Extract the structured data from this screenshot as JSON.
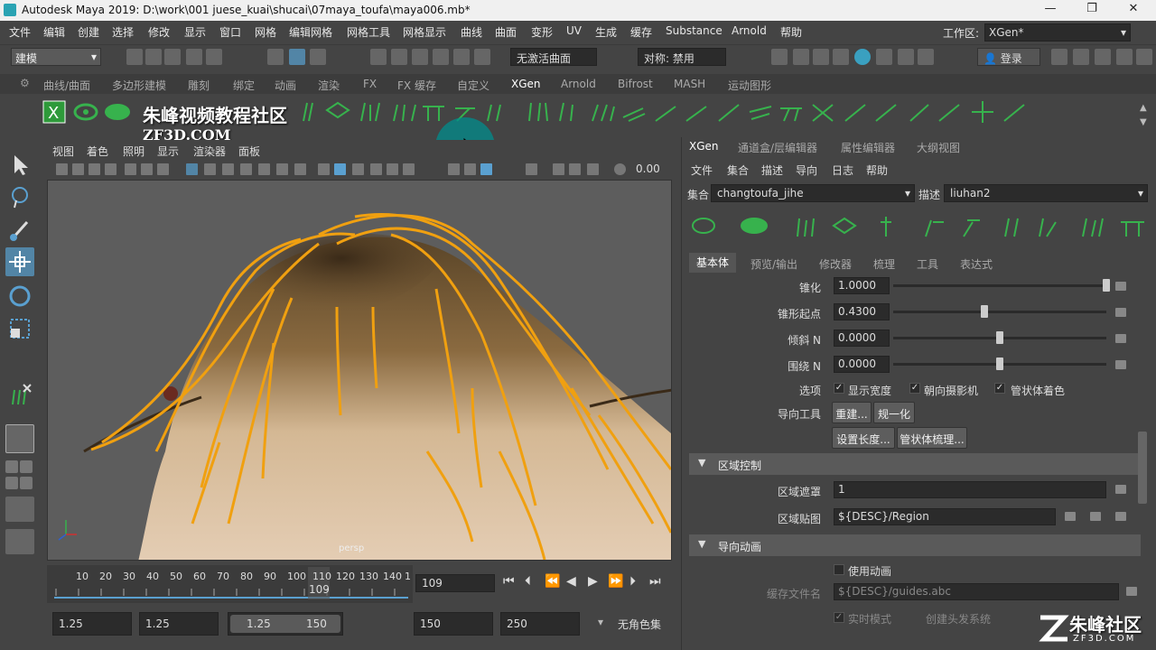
{
  "window": {
    "title": "Autodesk Maya 2019: D:\\work\\001 juese_kuai\\shucai\\07maya_toufa\\maya006.mb*",
    "minimize": "—",
    "maximize": "❐",
    "close": "✕"
  },
  "menubar": {
    "items": [
      "文件",
      "编辑",
      "创建",
      "选择",
      "修改",
      "显示",
      "窗口",
      "网格",
      "编辑网格",
      "网格工具",
      "网格显示",
      "曲线",
      "曲面",
      "变形",
      "UV",
      "生成",
      "缓存",
      "Substance",
      "Arnold",
      "帮助"
    ],
    "workspace_label": "工作区:",
    "workspace_value": "XGen*"
  },
  "toolbar": {
    "mode": "建模",
    "live_surface": "无激活曲面",
    "symmetry": "对称: 禁用",
    "login": "登录"
  },
  "shelf_tabs": {
    "items": [
      "曲线/曲面",
      "多边形建模",
      "雕刻",
      "绑定",
      "动画",
      "渲染",
      "FX",
      "FX 缓存",
      "自定义",
      "XGen",
      "Arnold",
      "Bifrost",
      "MASH",
      "运动图形"
    ],
    "active": "XGen"
  },
  "watermark": {
    "line1": "朱峰视频教程社区",
    "line2": "ZF3D.COM"
  },
  "viewport": {
    "menu": [
      "视图",
      "着色",
      "照明",
      "显示",
      "渲染器",
      "面板"
    ],
    "exposure": "0.00",
    "camera_label": "persp"
  },
  "timeline": {
    "ticks": [
      "10",
      "20",
      "30",
      "40",
      "50",
      "60",
      "70",
      "80",
      "90",
      "100",
      "110",
      "120",
      "130",
      "140",
      "1"
    ],
    "current_frame_marker": "109",
    "current_frame_field": "109"
  },
  "range": {
    "start": "1.25",
    "playback_start": "1.25",
    "slider_start": "1.25",
    "slider_end": "150",
    "playback_end": "150",
    "end": "250",
    "character_set": "无角色集"
  },
  "panel": {
    "tabs": [
      "XGen",
      "通道盒/层编辑器",
      "属性编辑器",
      "大纲视图"
    ],
    "active_tab": "XGen",
    "menu": [
      "文件",
      "集合",
      "描述",
      "导向",
      "日志",
      "帮助"
    ],
    "collection_label": "集合",
    "collection_value": "changtoufa_jihe",
    "description_label": "描述",
    "description_value": "liuhan2",
    "subtabs": [
      "基本体",
      "预览/输出",
      "修改器",
      "梳理",
      "工具",
      "表达式"
    ],
    "active_subtab": "基本体",
    "rows": [
      {
        "label": "锥化",
        "value": "1.0000",
        "level": 1.0
      },
      {
        "label": "锥形起点",
        "value": "0.4300",
        "level": 0.43
      },
      {
        "label": "倾斜 N",
        "value": "0.0000",
        "level": 0.5
      },
      {
        "label": "围绕 N",
        "value": "0.0000",
        "level": 0.5
      }
    ],
    "options_label": "选项",
    "options": [
      {
        "label": "显示宽度",
        "checked": true
      },
      {
        "label": "朝向摄影机",
        "checked": true
      },
      {
        "label": "管状体着色",
        "checked": true
      }
    ],
    "guide_tools_label": "导向工具",
    "buttons": [
      "重建...",
      "规一化",
      "设置长度...",
      "管状体梳理..."
    ],
    "region_section": "区域控制",
    "region_mask_label": "区域遮罩",
    "region_mask_value": "1",
    "region_map_label": "区域贴图",
    "region_map_value": "${DESC}/Region",
    "guide_anim_section": "导向动画",
    "use_anim_label": "使用动画",
    "cache_file_label": "缓存文件名",
    "cache_file_value": "${DESC}/guides.abc",
    "live_mode_label": "实时模式",
    "create_hair_label": "创建头发系统"
  },
  "corner_logo": {
    "text": "朱峰社区",
    "sub": "ZF3D.COM"
  },
  "colors": {
    "accent": "#5285a6",
    "xgen_green": "#37b24d",
    "guide_orange": "#f0a010"
  }
}
